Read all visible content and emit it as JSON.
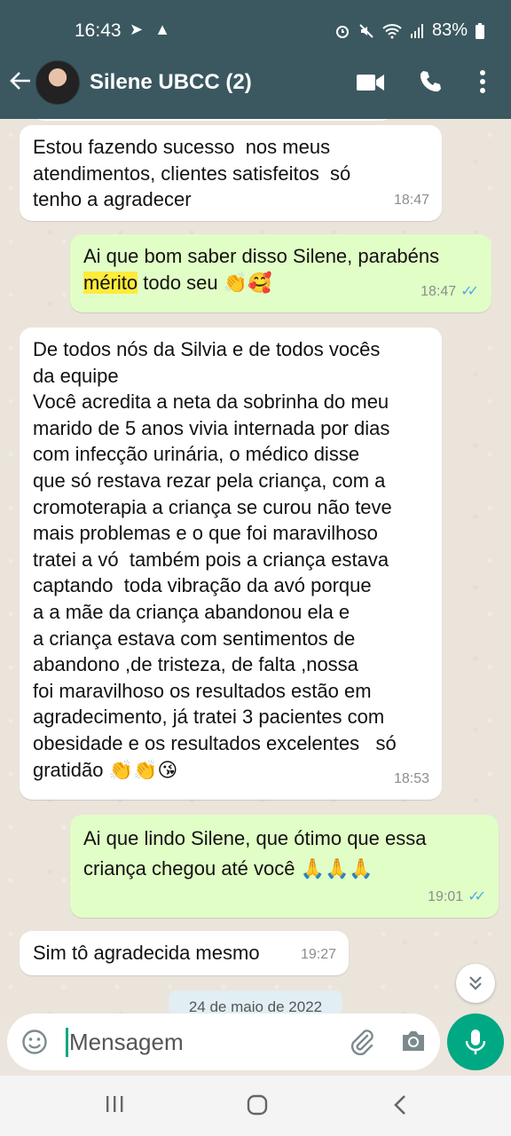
{
  "status_bar": {
    "time": "16:43",
    "left_icons": "➤ ▲",
    "battery": "83%"
  },
  "app_bar": {
    "title": "Silene UBCC (2)"
  },
  "messages": [
    {
      "direction": "in",
      "text": "Estou fazendo sucesso  nos meus\natendimentos, clientes satisfeitos  só\ntenho a agradecer",
      "time": "18:47"
    },
    {
      "direction": "out",
      "text_before": "Ai que bom saber disso Silene, parabéns\n",
      "highlighted": "mérito",
      "text_after": " todo seu 👏🥰",
      "time": "18:47",
      "status": "read"
    },
    {
      "direction": "in",
      "text": "De todos nós da Silvia e de todos vocês\nda equipe\nVocê acredita a neta da sobrinha do meu\nmarido de 5 anos vivia internada por dias\ncom infecção urinária, o médico disse\nque só restava rezar pela criança, com a\ncromoterapia a criança se curou não teve\nmais problemas e o que foi maravilhoso\ntratei a vó  também pois a criança estava\ncaptando  toda vibração da avó porque\na a mãe da criança abandonou ela e\na criança estava com sentimentos de\nabandono ,de tristeza, de falta ,nossa\nfoi maravilhoso os resultados estão em\nagradecimento, já tratei 3 pacientes com\nobesidade e os resultados excelentes   só\ngratidão 👏👏😘",
      "time": "18:53"
    },
    {
      "direction": "out",
      "text": "Ai que lindo Silene, que ótimo que essa\ncriança chegou até você 🙏🙏🙏",
      "time": "19:01",
      "status": "read"
    },
    {
      "direction": "in",
      "text": "Sim tô agradecida mesmo",
      "time": "19:27"
    }
  ],
  "date_divider": "24 de maio de 2022",
  "composer": {
    "placeholder": "Mensagem"
  },
  "colors": {
    "header": "#3b5860",
    "outgoing_bubble": "#e1fec6",
    "incoming_bubble": "#ffffff",
    "accent": "#00a884",
    "read_ticks": "#4fa9e6",
    "highlight": "#ffeb3b"
  },
  "icons": {
    "back": "arrow-left-icon",
    "video": "video-camera-icon",
    "call": "phone-icon",
    "menu": "more-vertical-icon",
    "scroll": "double-chevron-down-icon",
    "emoji": "emoji-icon",
    "attach": "paperclip-icon",
    "camera": "camera-icon",
    "mic": "microphone-icon"
  }
}
